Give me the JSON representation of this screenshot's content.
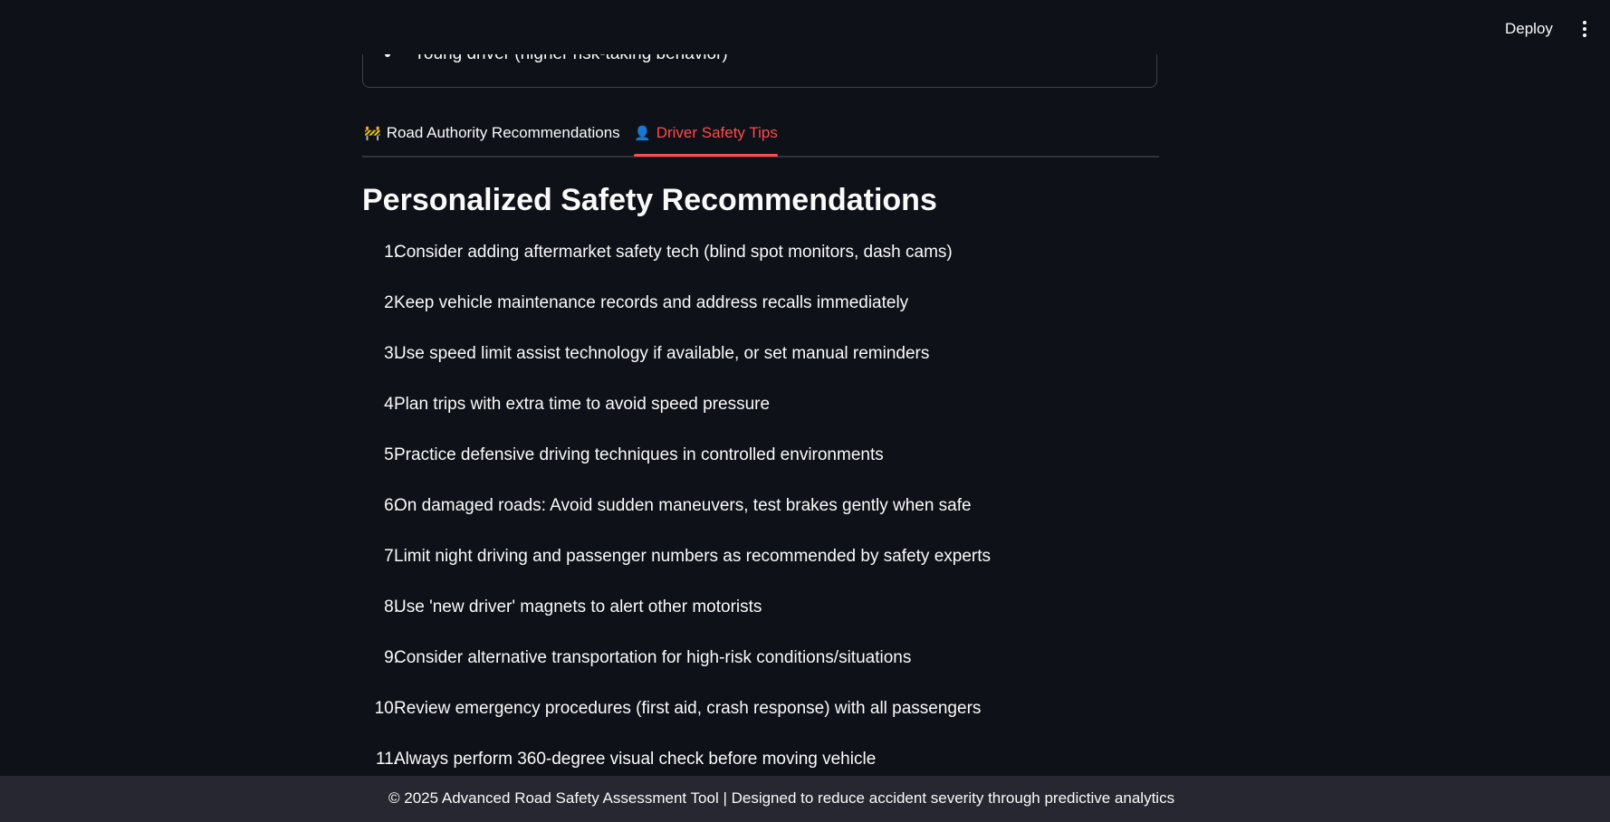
{
  "header": {
    "deploy_label": "Deploy",
    "menu_icon": "vertical-ellipsis-icon"
  },
  "expander": {
    "visible_item": "Young driver (higher risk-taking behavior)"
  },
  "tabs": [
    {
      "icon": "🚧",
      "icon_name": "construction-barrier-icon",
      "label": "Road Authority Recommendations",
      "active": false
    },
    {
      "icon": "👤",
      "icon_name": "person-icon",
      "label": "Driver Safety Tips",
      "active": true
    }
  ],
  "section": {
    "title": "Personalized Safety Recommendations",
    "items": [
      {
        "num": "1.",
        "text": "Consider adding aftermarket safety tech (blind spot monitors, dash cams)"
      },
      {
        "num": "2.",
        "text": "Keep vehicle maintenance records and address recalls immediately"
      },
      {
        "num": "3.",
        "text": "Use speed limit assist technology if available, or set manual reminders"
      },
      {
        "num": "4.",
        "text": "Plan trips with extra time to avoid speed pressure"
      },
      {
        "num": "5.",
        "text": "Practice defensive driving techniques in controlled environments"
      },
      {
        "num": "6.",
        "text": "On damaged roads: Avoid sudden maneuvers, test brakes gently when safe"
      },
      {
        "num": "7.",
        "text": "Limit night driving and passenger numbers as recommended by safety experts"
      },
      {
        "num": "8.",
        "text": "Use 'new driver' magnets to alert other motorists"
      },
      {
        "num": "9.",
        "text": "Consider alternative transportation for high-risk conditions/situations"
      },
      {
        "num": "10.",
        "text": "Review emergency procedures (first aid, crash response) with all passengers"
      },
      {
        "num": "11.",
        "text": "Always perform 360-degree visual check before moving vehicle"
      }
    ]
  },
  "footer": {
    "text": "© 2025 Advanced Road Safety Assessment Tool | Designed to reduce accident severity through predictive analytics"
  },
  "colors": {
    "background": "#0e1117",
    "accent": "#ff4b4b",
    "footer_bg": "#262730",
    "text": "#fafafa"
  }
}
